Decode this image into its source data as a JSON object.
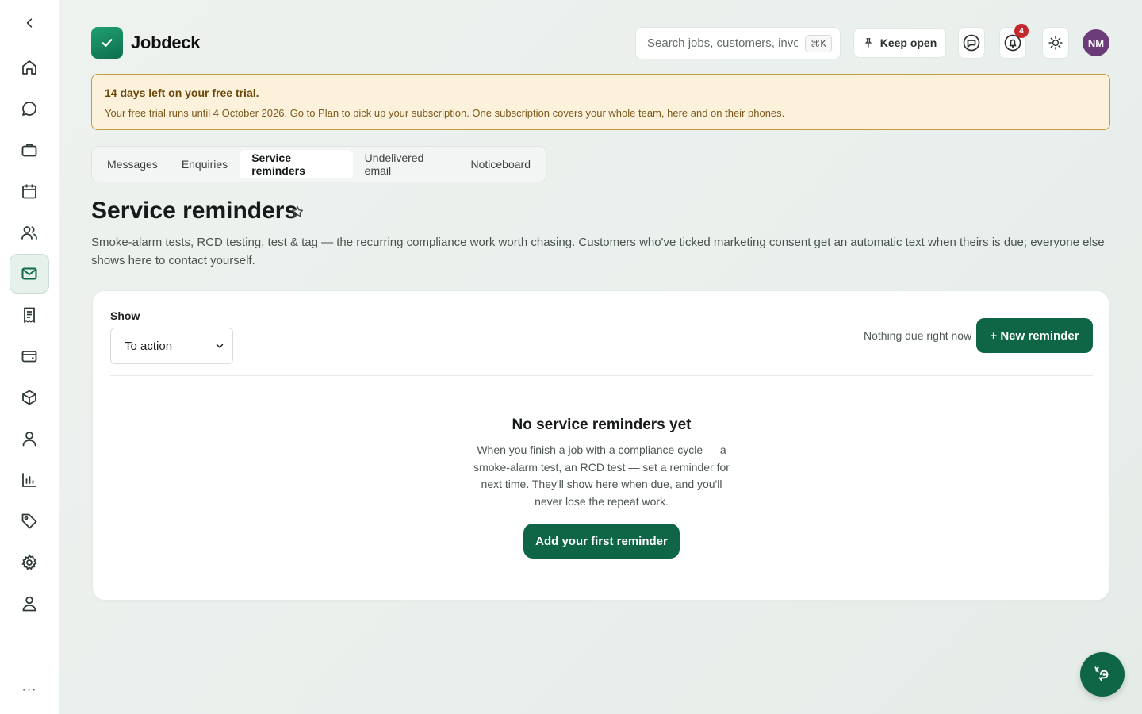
{
  "sidebar": {
    "collapse_icon": "chevron-left-icon",
    "more_label": "···",
    "items": [
      {
        "icon": "home-icon",
        "name": "home"
      },
      {
        "icon": "chat-icon",
        "name": "messages"
      },
      {
        "icon": "briefcase-icon",
        "name": "jobs"
      },
      {
        "icon": "calendar-icon",
        "name": "calendar"
      },
      {
        "icon": "users-icon",
        "name": "customers"
      },
      {
        "icon": "mail-icon",
        "name": "inbox",
        "active": true
      },
      {
        "icon": "receipt-icon",
        "name": "invoices"
      },
      {
        "icon": "wallet-icon",
        "name": "payments"
      },
      {
        "icon": "box-icon",
        "name": "products"
      },
      {
        "icon": "person-icon",
        "name": "team"
      },
      {
        "icon": "bar-chart-icon",
        "name": "reports"
      },
      {
        "icon": "tag-icon",
        "name": "pricing"
      },
      {
        "icon": "gear-icon",
        "name": "settings"
      },
      {
        "icon": "user-icon",
        "name": "account"
      }
    ]
  },
  "header": {
    "brand": "Jobdeck",
    "search_placeholder": "Search jobs, customers, invoices",
    "search_shortcut": "⌘K",
    "keep_open_label": "Keep open",
    "notification_count": "4",
    "avatar_initials": "NM"
  },
  "trial": {
    "title": "14 days left on your free trial.",
    "text": "Your free trial runs until 4 October 2026. Go to Plan to pick up your subscription. One subscription covers your whole team, here and on their phones."
  },
  "tabs": [
    {
      "label": "Messages"
    },
    {
      "label": "Enquiries"
    },
    {
      "label": "Service reminders",
      "active": true
    },
    {
      "label": "Undelivered email"
    },
    {
      "label": "Noticeboard"
    }
  ],
  "page": {
    "title": "Service reminders",
    "description": "Smoke-alarm tests, RCD testing, test & tag — the recurring compliance work worth chasing. Customers who've ticked marketing consent get an automatic text when theirs is due; everyone else shows here to contact yourself."
  },
  "card": {
    "show_label": "Show",
    "show_value": "To action",
    "status_text": "Nothing due right now",
    "new_button": "+ New reminder",
    "empty_title": "No service reminders yet",
    "empty_text": "When you finish a job with a compliance cycle — a smoke-alarm test, an RCD test — set a reminder for next time. They'll show here when due, and you'll never lose the repeat work.",
    "first_button": "Add your first reminder"
  },
  "colors": {
    "accent": "#0f6647",
    "trial_bg": "#fcf1da",
    "trial_border": "#c69a45",
    "badge": "#c4282d",
    "avatar": "#6c3c7a"
  }
}
